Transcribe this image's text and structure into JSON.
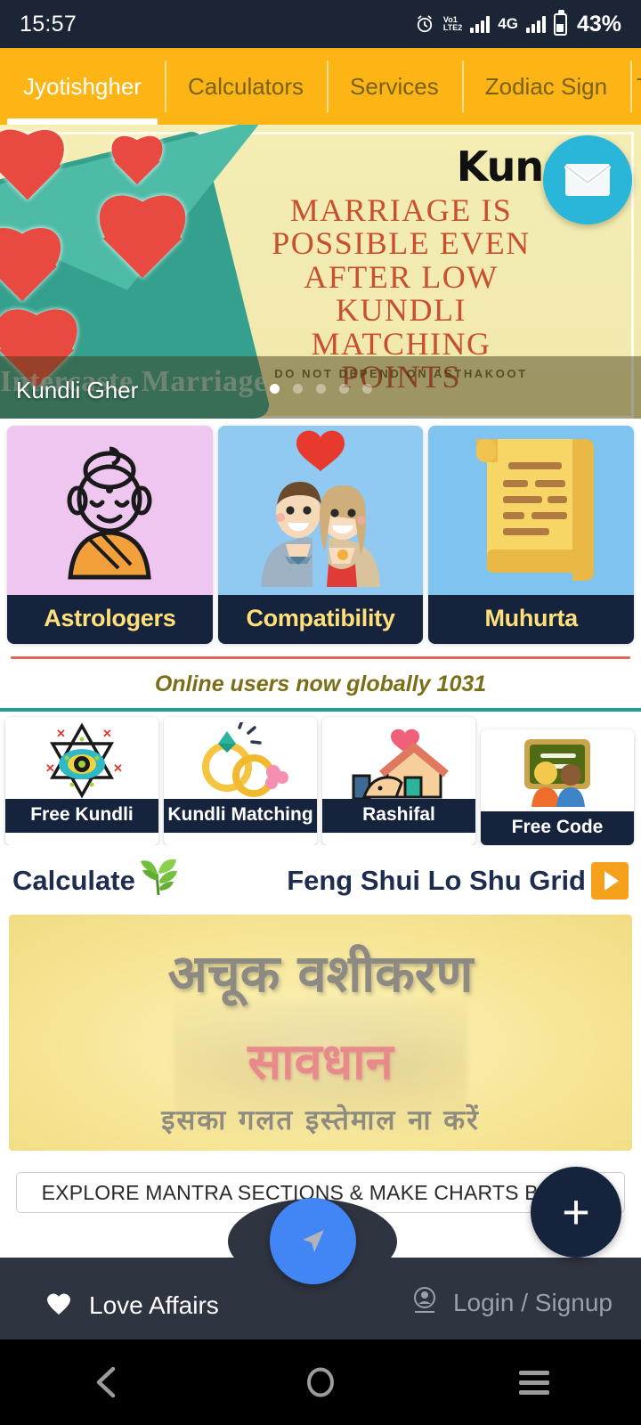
{
  "status_bar": {
    "time": "15:57",
    "alarm_icon": "alarm-icon",
    "volte_top": "VoLTE",
    "volte_label_1": "Vo1",
    "volte_label_2": "LTE2",
    "network_type": "4G",
    "battery_percent": "43%"
  },
  "tabs": [
    {
      "label": "Jyotishgher",
      "active": true
    },
    {
      "label": "Calculators",
      "active": false
    },
    {
      "label": "Services",
      "active": false
    },
    {
      "label": "Zodiac Sign",
      "active": false
    },
    {
      "label": "T",
      "active": false
    }
  ],
  "carousel": {
    "caption": "Kundli Gher",
    "wordmark": "Kund",
    "headline_lines": [
      "MARRIAGE IS",
      "POSSIBLE EVEN",
      "AFTER LOW",
      "KUNDLI",
      "MATCHING",
      "POINTS"
    ],
    "subtext": "DO NOT DEPEND ON ASTHAKOOT",
    "ghost_text": "Intercaste Marriage",
    "dots_total": 5,
    "dot_active_index": 0,
    "mail_fab_icon": "envelope-icon"
  },
  "feature_cards": [
    {
      "label": "Astrologers",
      "icon": "buddha-icon",
      "bg": "#eec6ef"
    },
    {
      "label": "Compatibility",
      "icon": "couple-heart-icon",
      "bg": "#90c9f2"
    },
    {
      "label": "Muhurta",
      "icon": "scroll-icon",
      "bg": "#7fc3f0"
    }
  ],
  "online_banner": {
    "text": "Online users now globally 1031",
    "count": "1031",
    "rule_top_color": "#e1675c",
    "rule_bottom_color": "#1f9e93"
  },
  "quick_tiles": [
    {
      "label": "Free Kundli",
      "icon": "star-eye-icon"
    },
    {
      "label": "Kundli Matching",
      "icon": "rings-icon"
    },
    {
      "label": "Rashifal",
      "icon": "house-heart-icon"
    },
    {
      "label": "Free Code",
      "icon": "blackboard-people-icon"
    }
  ],
  "calculate_row": {
    "left_label": "Calculate",
    "leaf_icon": "leaf-icon",
    "title": "Feng Shui Lo Shu Grid",
    "play_icon": "play-icon"
  },
  "hindi_banner": {
    "line1": "अचूक वशीकरण",
    "line2": "सावधान",
    "line3": "इसका गलत इस्तेमाल ना करें"
  },
  "explore_bar": {
    "text": "EXPLORE MANTRA SECTIONS & MAKE CHARTS BELOW"
  },
  "bottom_nav": {
    "left_label": "Love Affairs",
    "left_icon": "heart-icon",
    "right_label": "Login / Signup",
    "right_icon": "account-icon",
    "center_icon": "navigate-icon",
    "fab_plus_label": "+",
    "accent_color": "#4285F4",
    "bar_color": "#2e3440"
  },
  "android_nav": {
    "back_icon": "back-chevron-icon",
    "home_icon": "home-circle-icon",
    "recents_icon": "menu-lines-icon"
  }
}
